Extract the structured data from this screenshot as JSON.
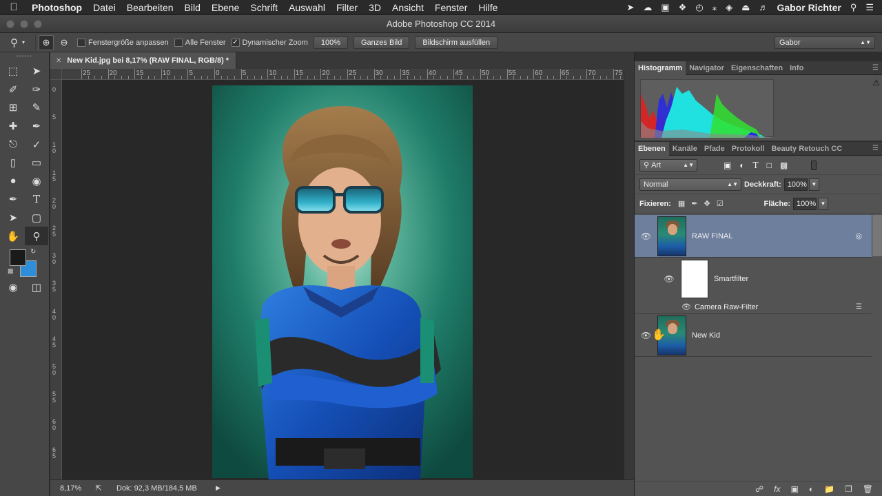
{
  "menubar": {
    "apple_icon": "apple-logo",
    "items": [
      "Photoshop",
      "Datei",
      "Bearbeiten",
      "Bild",
      "Ebene",
      "Schrift",
      "Auswahl",
      "Filter",
      "3D",
      "Ansicht",
      "Fenster",
      "Hilfe"
    ],
    "user": "Gabor Richter"
  },
  "window": {
    "title": "Adobe Photoshop CC 2014"
  },
  "options": {
    "fit_window": "Fenstergröße anpassen",
    "all_windows": "Alle Fenster",
    "scrubby_zoom": "Dynamischer Zoom",
    "btn_100": "100%",
    "btn_fit": "Ganzes Bild",
    "btn_fill": "Bildschirm ausfüllen",
    "workspace": "Gabor"
  },
  "document": {
    "tab_title": "New Kid.jpg bei 8,17% (RAW FINAL, RGB/8) *",
    "ruler_h": [
      "25",
      "20",
      "15",
      "10",
      "5",
      "0",
      "5",
      "10",
      "15",
      "20",
      "25",
      "30",
      "35",
      "40",
      "45",
      "50",
      "55",
      "60",
      "65",
      "70",
      "75"
    ],
    "ruler_v": [
      "0",
      "5",
      "10",
      "15",
      "20",
      "25",
      "30",
      "35",
      "40",
      "45",
      "50",
      "55",
      "60",
      "65"
    ],
    "zoom": "8,17%",
    "doc_info": "Dok: 92,3 MB/184,5 MB"
  },
  "histogram_panel": {
    "tabs": [
      "Histogramm",
      "Navigator",
      "Eigenschaften",
      "Info"
    ]
  },
  "layers_panel": {
    "tabs": [
      "Ebenen",
      "Kanäle",
      "Pfade",
      "Protokoll",
      "Beauty Retouch CC"
    ],
    "filter_kind": "Art",
    "blend_mode": "Normal",
    "opacity_label": "Deckkraft:",
    "opacity": "100%",
    "lock_label": "Fixieren:",
    "fill_label": "Fläche:",
    "fill": "100%",
    "layers": [
      {
        "name": "RAW FINAL",
        "selected": true
      },
      {
        "name": "New Kid",
        "selected": false
      }
    ],
    "smartfilter_label": "Smartfilter",
    "filter_name": "Camera Raw-Filter"
  }
}
